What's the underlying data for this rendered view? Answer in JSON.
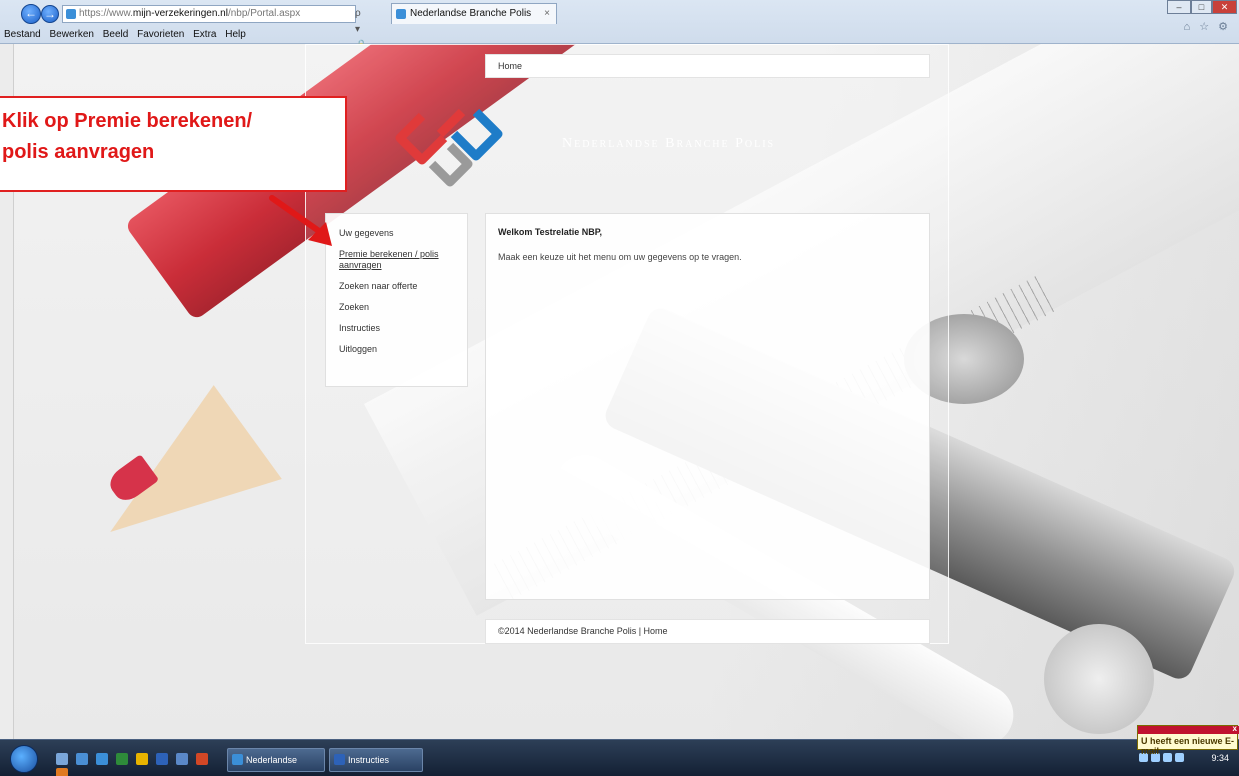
{
  "browser": {
    "url_prefix": "https://www.",
    "url_domain": "mijn-verzekeringen.nl",
    "url_path": "/nbp/Portal.aspx",
    "url_tools": "ρ ▾ 🔒 ⊞ C ✕",
    "tab_title": "Nederlandse Branche Polis",
    "tab_close": "×",
    "win_min": "‒",
    "win_max": "□",
    "win_close": "✕",
    "tool_icons": "⌂ ☆ ⚙"
  },
  "menubar": [
    "Bestand",
    "Bewerken",
    "Beeld",
    "Favorieten",
    "Extra",
    "Help"
  ],
  "page": {
    "breadcrumb": "Home",
    "brand": "Nederlandse Branche Polis",
    "menu": [
      {
        "label": "Uw gegevens"
      },
      {
        "label": "Premie berekenen / polis aanvragen"
      },
      {
        "label": "Zoeken naar offerte"
      },
      {
        "label": "Zoeken"
      },
      {
        "label": "Instructies"
      },
      {
        "label": "Uitloggen"
      }
    ],
    "welcome": "Welkom Testrelatie NBP,",
    "intro": "Maak een keuze uit het menu om uw gegevens op te vragen.",
    "footer": "©2014 Nederlandse Branche Polis | Home"
  },
  "callout": {
    "line1": "Klik op Premie berekenen/",
    "line2": "polis aanvragen"
  },
  "taskbar": {
    "task1": "Nederlandse Branch...",
    "task2": "Instructies interneta...",
    "time": "9:34",
    "notification": "U heeft een nieuwe E-mail",
    "notification_close": "x"
  },
  "colors": {
    "accent_red": "#e01818",
    "logo_red": "#e03a3a",
    "logo_blue": "#1e7cc8",
    "logo_grey": "#9a9a9a"
  }
}
